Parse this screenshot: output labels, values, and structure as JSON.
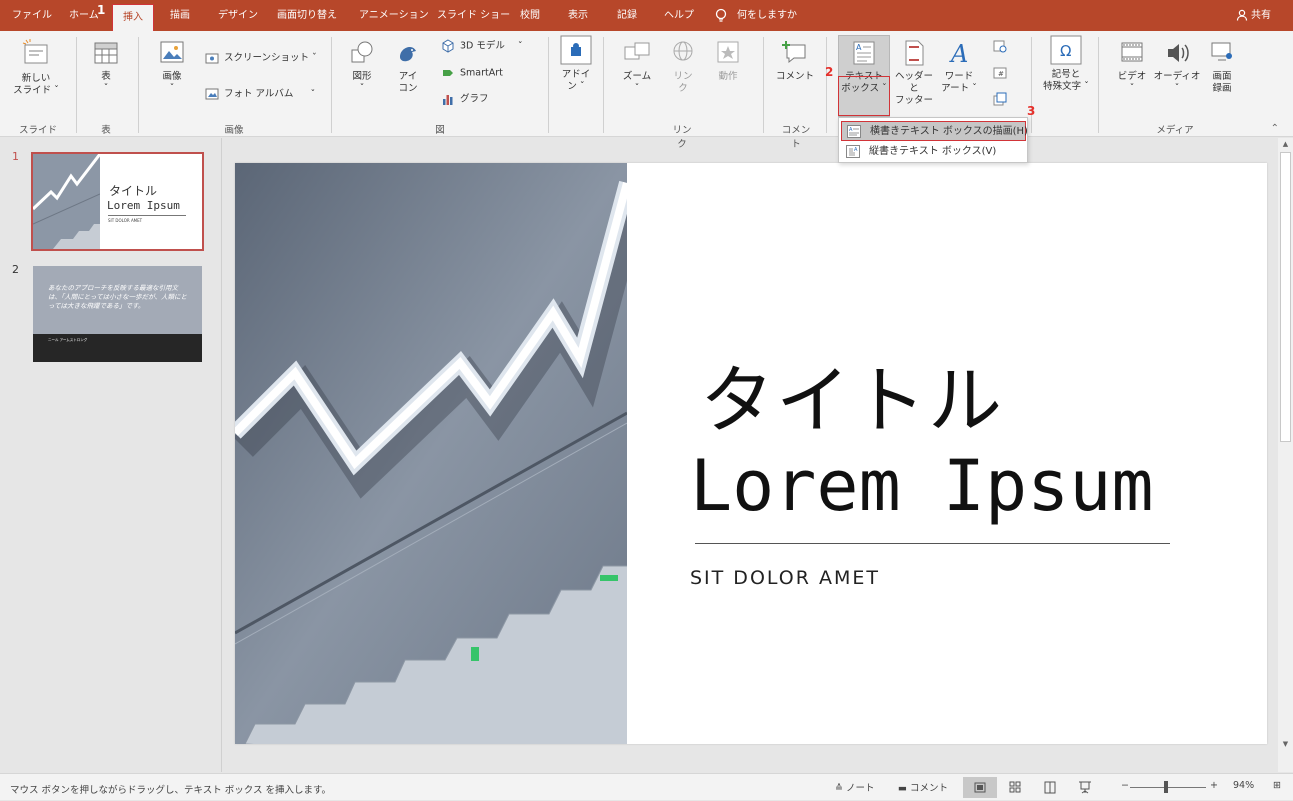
{
  "tabs": {
    "file": "ファイル",
    "home": "ホーム",
    "insert": "挿入",
    "draw": "描画",
    "design": "デザイン",
    "transitions": "画面切り替え",
    "animations": "アニメーション",
    "slideshow": "スライド ショー",
    "review": "校閲",
    "view": "表示",
    "recording": "記録",
    "help": "ヘルプ",
    "tellme": "何をしますか",
    "share": "共有"
  },
  "annotations": {
    "step1": "1",
    "step2": "2",
    "step3": "3",
    "color": "#e5302b"
  },
  "ribbon": {
    "new_slide": [
      "新しい",
      "スライド ˇ"
    ],
    "table": [
      "表",
      "ˇ"
    ],
    "images": [
      "画像",
      "ˇ"
    ],
    "screenshot": "スクリーンショット ˇ",
    "photo_album": "フォト アルバム",
    "shapes": [
      "図形",
      "ˇ"
    ],
    "icons": [
      "アイ",
      "コン"
    ],
    "model3d": "3D モデル",
    "smartart": "SmartArt",
    "chart": "グラフ",
    "addins": [
      "アドイ",
      "ン ˇ"
    ],
    "zoom": [
      "ズーム",
      "ˇ"
    ],
    "link": [
      "リン",
      "ク"
    ],
    "action": "動作",
    "comment": "コメント",
    "textbox": [
      "テキスト",
      "ボックス ˇ"
    ],
    "header_footer": [
      "ヘッダーと",
      "フッター"
    ],
    "wordart": [
      "ワード",
      "アート ˇ"
    ],
    "symbols": [
      "記号と",
      "特殊文字 ˇ"
    ],
    "video": [
      "ビデオ",
      "ˇ"
    ],
    "audio": [
      "オーディオ",
      "ˇ"
    ],
    "screen_recording": [
      "画面",
      "録画"
    ],
    "groups": {
      "slides": "スライド",
      "tables": "表",
      "images": "画像",
      "illustrations": "図",
      "links": "リンク",
      "comments": "コメント",
      "media": "メディア"
    }
  },
  "textbox_menu": {
    "horizontal": "横書きテキスト ボックスの描画(H)",
    "vertical": "縦書きテキスト ボックス(V)"
  },
  "slides": [
    {
      "number": "1",
      "title": "タイトル",
      "subtitle": "Lorem Ipsum",
      "tag": "SIT DOLOR AMET"
    },
    {
      "number": "2",
      "quote": "あなたのアプローチを反映する最適な引用文は、「人間にとっては小さな一歩だが、人類にとっては大きな飛躍である」です。",
      "author": "ニール アームストロング"
    }
  ],
  "slide": {
    "title": "タイトル",
    "subtitle": "Lorem Ipsum",
    "tagline": "SIT DOLOR AMET"
  },
  "statusbar": {
    "message": "マウス ボタンを押しながらドラッグし、テキスト ボックス を挿入します。",
    "notes": "ノート",
    "comments": "コメント",
    "zoom_minus": "−",
    "zoom_plus": "+",
    "zoom": "94%",
    "zoom_fraction": 0.47
  },
  "colors": {
    "accent": "#b7472a",
    "highlight_border": "#d13438",
    "selected_thumb": "#c0504d"
  }
}
